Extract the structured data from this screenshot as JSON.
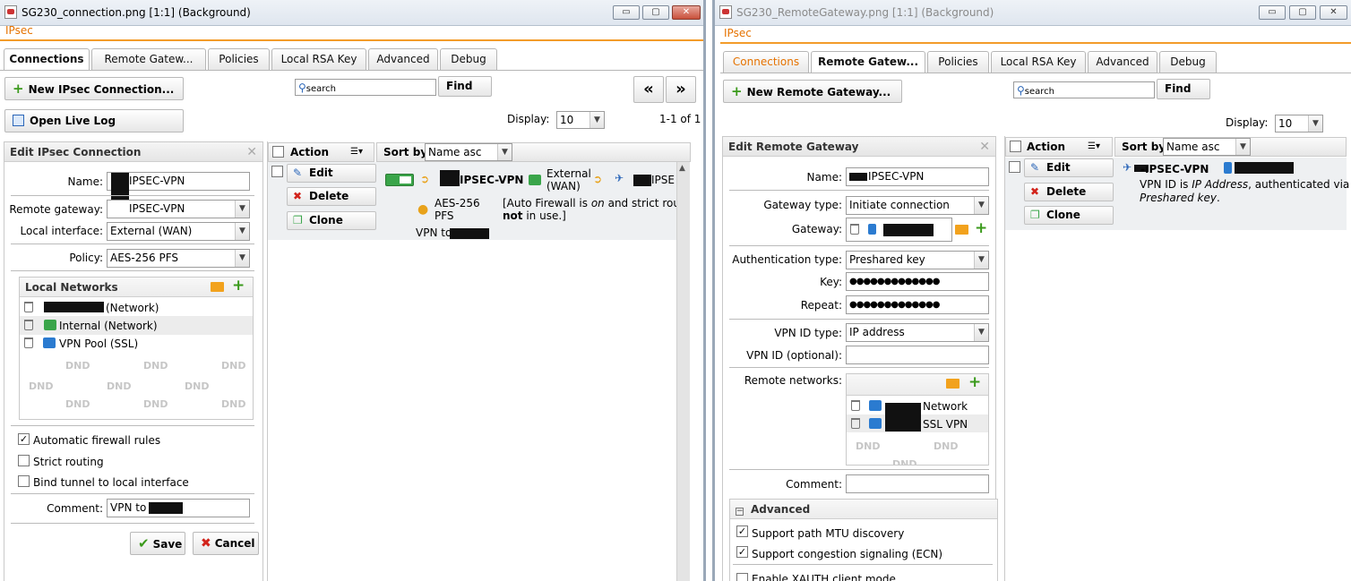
{
  "left": {
    "title": "SG230_connection.png [1:1] (Background)",
    "brand": "IPsec",
    "tabs": [
      "Connections",
      "Remote Gatew...",
      "Policies",
      "Local RSA Key",
      "Advanced",
      "Debug"
    ],
    "new_button": "New IPsec Connection...",
    "open_log": "Open Live Log",
    "search_placeholder": "search",
    "find": "Find",
    "prev": "«",
    "next": "»",
    "display_label": "Display:",
    "display_value": "10",
    "range": "1-1 of 1",
    "edit_panel": {
      "title": "Edit IPsec Connection",
      "name_label": "Name:",
      "name_value": "IPSEC-VPN",
      "gateway_label": "Remote gateway:",
      "gateway_value": "IPSEC-VPN",
      "iface_label": "Local interface:",
      "iface_value": "External (WAN)",
      "policy_label": "Policy:",
      "policy_value": "AES-256 PFS",
      "local_networks": "Local Networks",
      "networks": [
        "(Network)",
        "Internal (Network)",
        "VPN Pool (SSL)"
      ],
      "dnd": "DND",
      "auto_fw": "Automatic firewall rules",
      "strict": "Strict routing",
      "bind": "Bind tunnel to local interface",
      "comment_label": "Comment:",
      "comment_value": "VPN to",
      "save": "Save",
      "cancel": "Cancel"
    },
    "grid": {
      "action_header": "Action",
      "sort_label": "Sort by:",
      "sort_value": "Name asc",
      "edit": "Edit",
      "delete": "Delete",
      "clone": "Clone",
      "conn_name": "IPSEC-VPN",
      "iface_1": "External",
      "iface_2": "(WAN)",
      "gw_name": "IPSE",
      "policy_1": "AES-256",
      "policy_2": "PFS",
      "note_pre": "[Auto Firewall is ",
      "note_on": "on",
      "note_mid": " and strict routing",
      "note_not": "not",
      "note_post": " in use.]",
      "vpn_to": "VPN to"
    }
  },
  "right": {
    "title": "SG230_RemoteGateway.png [1:1] (Background)",
    "brand": "IPsec",
    "tabs": [
      "Connections",
      "Remote Gatew...",
      "Policies",
      "Local RSA Key",
      "Advanced",
      "Debug"
    ],
    "new_button": "New Remote Gateway...",
    "search_placeholder": "search",
    "find": "Find",
    "display_label": "Display:",
    "display_value": "10",
    "edit_panel": {
      "title": "Edit Remote Gateway",
      "name_label": "Name:",
      "name_value": "IPSEC-VPN",
      "gwtype_label": "Gateway type:",
      "gwtype_value": "Initiate connection",
      "gateway_label": "Gateway:",
      "auth_label": "Authentication type:",
      "auth_value": "Preshared key",
      "key_label": "Key:",
      "key_value": "●●●●●●●●●●●●●",
      "repeat_label": "Repeat:",
      "repeat_value": "●●●●●●●●●●●●●",
      "vpnid_label": "VPN ID type:",
      "vpnid_value": "IP address",
      "vpnid_opt_label": "VPN ID (optional):",
      "remote_label": "Remote networks:",
      "remote_nets": [
        "Network",
        "SSL VPN"
      ],
      "dnd": "DND",
      "comment_label": "Comment:",
      "advanced": "Advanced",
      "pmtu": "Support path MTU discovery",
      "ecn": "Support congestion signaling (ECN)",
      "xauth": "Enable XAUTH client mode"
    },
    "grid": {
      "action_header": "Action",
      "sort_label": "Sort by:",
      "sort_value": "Name asc",
      "edit": "Edit",
      "delete": "Delete",
      "clone": "Clone",
      "gw_name": "-IPSEC-VPN",
      "desc_1": "VPN ID is ",
      "desc_ip": "IP Address",
      "desc_2": ", authenticated via",
      "desc_psk": "Preshared key",
      "desc_end": "."
    }
  }
}
